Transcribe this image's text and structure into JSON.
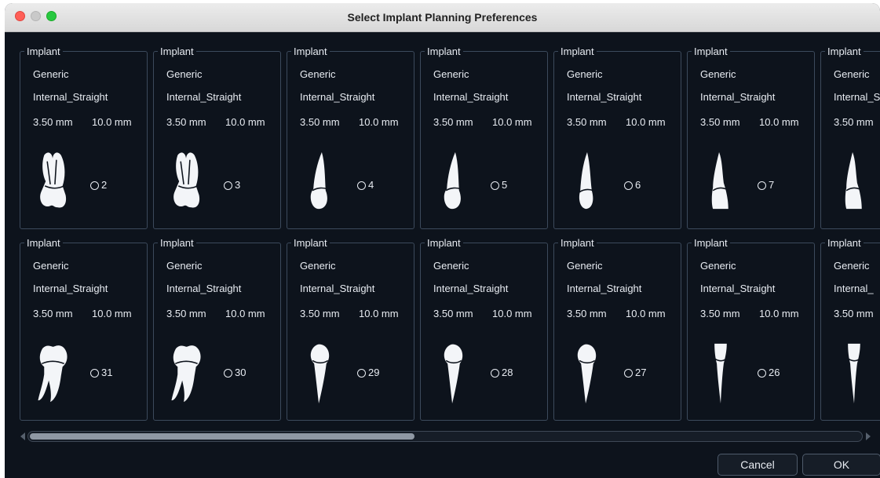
{
  "window": {
    "title": "Select Implant Planning Preferences"
  },
  "cards": [
    {
      "legend": "Implant",
      "brand": "Generic",
      "type": "Internal_Straight",
      "diameter": "3.50 mm",
      "length": "10.0 mm",
      "tooth": "2",
      "shape": "molar-upper"
    },
    {
      "legend": "Implant",
      "brand": "Generic",
      "type": "Internal_Straight",
      "diameter": "3.50 mm",
      "length": "10.0 mm",
      "tooth": "3",
      "shape": "molar-upper"
    },
    {
      "legend": "Implant",
      "brand": "Generic",
      "type": "Internal_Straight",
      "diameter": "3.50 mm",
      "length": "10.0 mm",
      "tooth": "4",
      "shape": "premolar-upper"
    },
    {
      "legend": "Implant",
      "brand": "Generic",
      "type": "Internal_Straight",
      "diameter": "3.50 mm",
      "length": "10.0 mm",
      "tooth": "5",
      "shape": "premolar-upper"
    },
    {
      "legend": "Implant",
      "brand": "Generic",
      "type": "Internal_Straight",
      "diameter": "3.50 mm",
      "length": "10.0 mm",
      "tooth": "6",
      "shape": "canine-upper"
    },
    {
      "legend": "Implant",
      "brand": "Generic",
      "type": "Internal_Straight",
      "diameter": "3.50 mm",
      "length": "10.0 mm",
      "tooth": "7",
      "shape": "incisor-upper"
    },
    {
      "legend": "Implant",
      "brand": "Generic",
      "type": "Internal_S",
      "diameter": "3.50 mm",
      "length": "",
      "tooth": "",
      "shape": "incisor-upper"
    },
    {
      "legend": "Implant",
      "brand": "Generic",
      "type": "Internal_Straight",
      "diameter": "3.50 mm",
      "length": "10.0 mm",
      "tooth": "31",
      "shape": "molar-lower"
    },
    {
      "legend": "Implant",
      "brand": "Generic",
      "type": "Internal_Straight",
      "diameter": "3.50 mm",
      "length": "10.0 mm",
      "tooth": "30",
      "shape": "molar-lower"
    },
    {
      "legend": "Implant",
      "brand": "Generic",
      "type": "Internal_Straight",
      "diameter": "3.50 mm",
      "length": "10.0 mm",
      "tooth": "29",
      "shape": "premolar-lower"
    },
    {
      "legend": "Implant",
      "brand": "Generic",
      "type": "Internal_Straight",
      "diameter": "3.50 mm",
      "length": "10.0 mm",
      "tooth": "28",
      "shape": "premolar-lower"
    },
    {
      "legend": "Implant",
      "brand": "Generic",
      "type": "Internal_Straight",
      "diameter": "3.50 mm",
      "length": "10.0 mm",
      "tooth": "27",
      "shape": "premolar-lower"
    },
    {
      "legend": "Implant",
      "brand": "Generic",
      "type": "Internal_Straight",
      "diameter": "3.50 mm",
      "length": "10.0 mm",
      "tooth": "26",
      "shape": "incisor-lower"
    },
    {
      "legend": "Implant",
      "brand": "Generic",
      "type": "Internal_",
      "diameter": "3.50 mm",
      "length": "",
      "tooth": "",
      "shape": "incisor-lower"
    }
  ],
  "scrollbar": {
    "position": 0.46
  },
  "buttons": {
    "cancel": "Cancel",
    "ok": "OK"
  },
  "colors": {
    "background": "#0d131c",
    "card_border": "#3c4a5c",
    "text": "#e8ecf2"
  }
}
